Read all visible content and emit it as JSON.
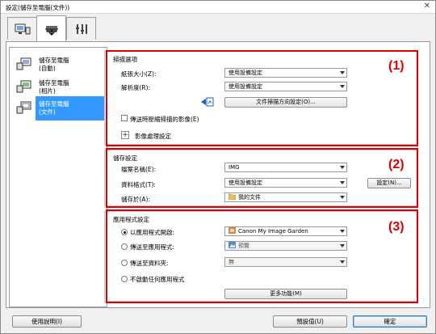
{
  "window": {
    "title": "設定(儲存至電腦(文件))",
    "close_glyph": "✕"
  },
  "tabs": [
    {
      "name": "scan-to-pc",
      "icon": "computer-scan-icon"
    },
    {
      "name": "scanner-button",
      "icon": "scanner-icon"
    },
    {
      "name": "general",
      "icon": "tools-icon"
    }
  ],
  "sidebar": {
    "items": [
      {
        "label": "儲存至電腦\n(自動)",
        "icon": "auto-save-icon"
      },
      {
        "label": "儲存至電腦\n(相片)",
        "icon": "photo-save-icon"
      },
      {
        "label": "儲存至電腦\n(文件)",
        "icon": "document-save-icon",
        "selected": true
      }
    ]
  },
  "scan_options": {
    "title": "掃描選項",
    "number": "(1)",
    "paper_size_label": "紙張大小(Z):",
    "paper_size_value": "使用設備設定",
    "resolution_label": "解析度(R):",
    "resolution_value": "使用設備設定",
    "orientation_button": "文件掃描方向設定(O)...",
    "compress_checkbox_label": "傳送時壓縮掃描的影像(E)",
    "image_processing_label": "影像處理設定",
    "plus_glyph": "+"
  },
  "save_settings": {
    "title": "儲存設定",
    "number": "(2)",
    "filename_label": "檔案名稱(E):",
    "filename_value": "IMG",
    "format_label": "資料格式(T):",
    "format_value": "使用設備設定",
    "settings_button": "設定(N)...",
    "save_in_label": "儲存於(A):",
    "save_in_value": "我的文件"
  },
  "app_settings": {
    "title": "應用程式設定",
    "number": "(3)",
    "open_with_label": "以應用程式開啟:",
    "open_with_value": "Canon My Image Garden",
    "send_app_label": "傳送至應用程式:",
    "send_app_value": "預覽",
    "send_folder_label": "傳送至資料夾:",
    "send_folder_value": "無",
    "no_launch_label": "不啟動任何應用程式",
    "more_button": "更多功能(M)"
  },
  "footer": {
    "help_button": "使用說明(I)",
    "defaults_button": "預設值(U)",
    "ok_button": "確定"
  },
  "colors": {
    "highlight": "#3399ff",
    "annotation_red": "#e00000",
    "accent_blue": "#1f5fbf"
  }
}
